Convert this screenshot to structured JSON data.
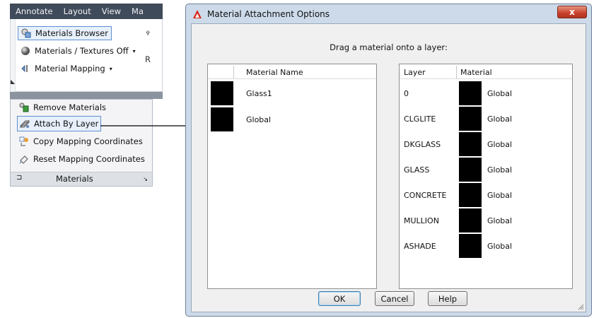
{
  "ribbon": {
    "tabs": [
      "Annotate",
      "Layout",
      "View",
      "Ma"
    ],
    "items": [
      "Materials Browser",
      "Materials / Textures Off",
      "Material Mapping"
    ],
    "side_letters": [
      "R"
    ]
  },
  "dropdown": {
    "items": [
      "Remove Materials",
      "Attach By Layer",
      "Copy Mapping Coordinates",
      "Reset Mapping Coordinates"
    ],
    "footer_label": "Materials"
  },
  "dialog": {
    "title": "Material Attachment Options",
    "close_glyph": "x",
    "instruction": "Drag a material onto a layer:",
    "materials_header": "Material Name",
    "materials": [
      "Glass1",
      "Global"
    ],
    "layers_header": [
      "Layer",
      "Material"
    ],
    "layers": [
      {
        "layer": "0",
        "material": "Global"
      },
      {
        "layer": "CLGLITE",
        "material": "Global"
      },
      {
        "layer": "DKGLASS",
        "material": "Global"
      },
      {
        "layer": "GLASS",
        "material": "Global"
      },
      {
        "layer": "CONCRETE",
        "material": "Global"
      },
      {
        "layer": "MULLION",
        "material": "Global"
      },
      {
        "layer": "ASHADE",
        "material": "Global"
      }
    ],
    "buttons": {
      "ok": "OK",
      "cancel": "Cancel",
      "help": "Help"
    }
  },
  "colors": {
    "swatch": "#000000",
    "title_accent": "#d9251c",
    "close_button": "#c8402a"
  }
}
